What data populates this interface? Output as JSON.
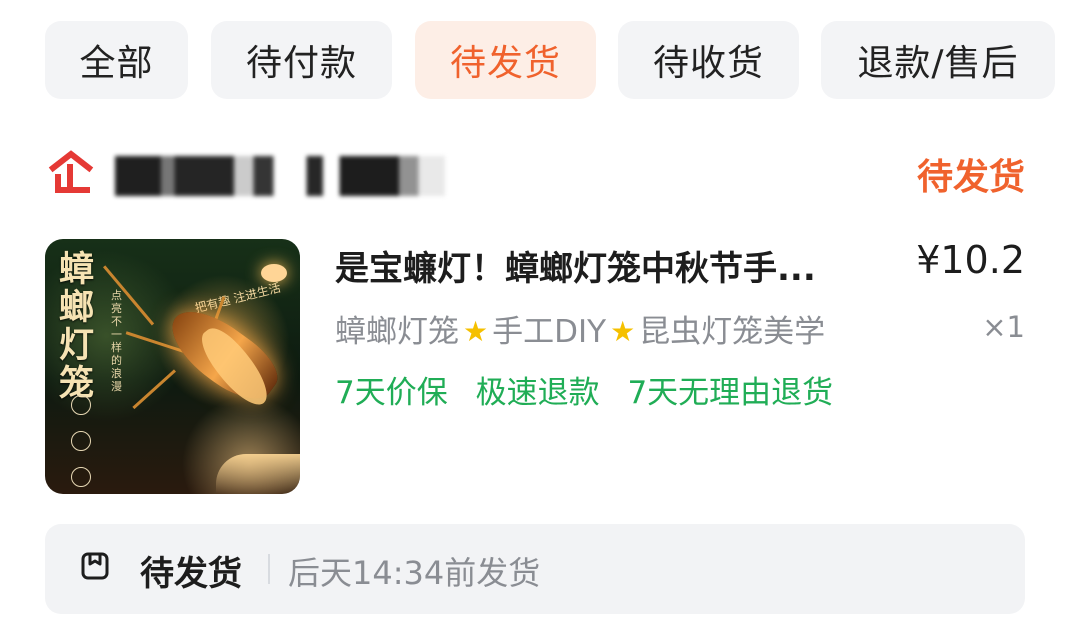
{
  "tabs": [
    {
      "label": "全部"
    },
    {
      "label": "待付款"
    },
    {
      "label": "待发货",
      "active": true
    },
    {
      "label": "待收货"
    },
    {
      "label": "退款/售后"
    }
  ],
  "shop": {
    "logo_icon": "store-icon",
    "status": "待发货"
  },
  "product": {
    "image_text": {
      "title": "蟑螂灯笼",
      "small_caption": "点亮不一样的浪漫",
      "side_note": "把有趣 注进生活"
    },
    "title": "是宝蠊灯！蟑螂灯笼中秋节手...",
    "price": "¥10.2",
    "spec": {
      "part1": "蟑螂灯笼",
      "star_icon": "star-icon",
      "part2": "手工DIY",
      "part3": "昆虫灯笼美学"
    },
    "quantity": "×1",
    "guarantees": [
      "7天价保",
      "极速退款",
      "7天无理由退货"
    ]
  },
  "shipping": {
    "icon": "package-icon",
    "label": "待发货",
    "text": "后天14:34前发货"
  },
  "colors": {
    "accent": "#f0622d",
    "green": "#20ad56",
    "muted": "#8a8d93",
    "tab_bg": "#f3f4f6",
    "active_tab_bg": "#fdeee6",
    "status_bg": "#f2f3f5"
  }
}
